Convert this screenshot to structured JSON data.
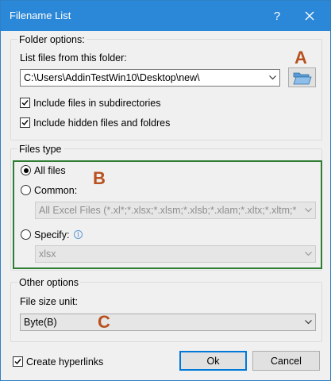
{
  "window": {
    "title": "Filename List",
    "help": "?",
    "close": "✕"
  },
  "folder_options": {
    "legend": "Folder options:",
    "list_label": "List files from this folder:",
    "path": "C:\\Users\\AddinTestWin10\\Desktop\\new\\",
    "include_subdirs": {
      "label": "Include files in subdirectories",
      "checked": true
    },
    "include_hidden": {
      "label": "Include hidden files and foldres",
      "checked": true
    }
  },
  "files_type": {
    "legend": "Files type",
    "all_files": {
      "label": "All files",
      "selected": true
    },
    "common": {
      "label": "Common:",
      "selected": false,
      "value": "All Excel Files (*.xl*;*.xlsx;*.xlsm;*.xlsb;*.xlam;*.xltx;*.xltm;*"
    },
    "specify": {
      "label": "Specify:",
      "selected": false,
      "value": "xlsx"
    }
  },
  "other_options": {
    "legend": "Other options",
    "size_label": "File size unit:",
    "size_value": "Byte(B)"
  },
  "footer": {
    "create_hyperlinks": {
      "label": "Create hyperlinks",
      "checked": true
    },
    "ok": "Ok",
    "cancel": "Cancel"
  },
  "annotations": {
    "a": "A",
    "b": "B",
    "c": "C"
  },
  "colors": {
    "titlebar": "#2b88d8",
    "annotation": "#b8501f",
    "highlight_box": "#2e7d32",
    "primary_border": "#0078d7"
  }
}
